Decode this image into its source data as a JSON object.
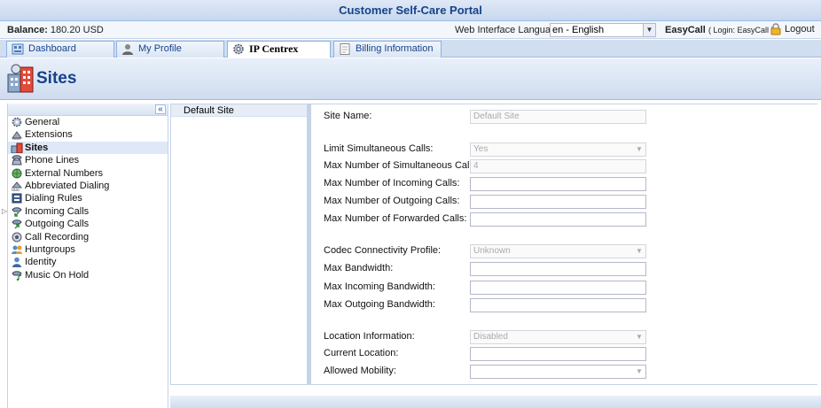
{
  "portal": {
    "title": "Customer Self-Care Portal"
  },
  "infobar": {
    "balance_label": "Balance:",
    "balance_value": "180.20 USD",
    "language_label": "Web Interface Language:",
    "language_value": "en - English",
    "user_name": "EasyCall",
    "login_text": "( Login: EasyCall )",
    "logout_label": "Logout"
  },
  "tabs": [
    {
      "label": "Dashboard",
      "icon": "dashboard-icon"
    },
    {
      "label": "My Profile",
      "icon": "profile-icon"
    },
    {
      "label": "IP Centrex",
      "icon": "gear-icon",
      "active": true
    },
    {
      "label": "Billing Information",
      "icon": "document-icon"
    }
  ],
  "page": {
    "title": "Sites"
  },
  "sidebar": {
    "collapse_label": "«",
    "items": [
      {
        "label": "General",
        "icon": "gear-icon"
      },
      {
        "label": "Extensions",
        "icon": "extensions-icon"
      },
      {
        "label": "Sites",
        "icon": "sites-icon",
        "selected": true
      },
      {
        "label": "Phone Lines",
        "icon": "phone-line-icon"
      },
      {
        "label": "External Numbers",
        "icon": "globe-phone-icon"
      },
      {
        "label": "Abbreviated Dialing",
        "icon": "abbreviated-dialing-icon"
      },
      {
        "label": "Dialing Rules",
        "icon": "dialing-rules-icon"
      },
      {
        "label": "Incoming Calls",
        "icon": "incoming-calls-icon",
        "expandable": true
      },
      {
        "label": "Outgoing Calls",
        "icon": "outgoing-calls-icon"
      },
      {
        "label": "Call Recording",
        "icon": "call-recording-icon"
      },
      {
        "label": "Huntgroups",
        "icon": "huntgroups-icon"
      },
      {
        "label": "Identity",
        "icon": "identity-icon"
      },
      {
        "label": "Music On Hold",
        "icon": "music-on-hold-icon"
      }
    ]
  },
  "sites": {
    "items": [
      "Default Site"
    ]
  },
  "form": {
    "site_name": {
      "label": "Site Name:",
      "value": "Default Site"
    },
    "limit_calls": {
      "label": "Limit Simultaneous Calls:",
      "value": "Yes"
    },
    "max_simultaneous": {
      "label": "Max Number of Simultaneous Calls:",
      "value": "4"
    },
    "max_incoming": {
      "label": "Max Number of Incoming Calls:",
      "value": ""
    },
    "max_outgoing": {
      "label": "Max Number of Outgoing Calls:",
      "value": ""
    },
    "max_forwarded": {
      "label": "Max Number of Forwarded Calls:",
      "value": ""
    },
    "codec_profile": {
      "label": "Codec Connectivity Profile:",
      "value": "Unknown"
    },
    "max_bandwidth": {
      "label": "Max Bandwidth:",
      "value": ""
    },
    "max_in_bandwidth": {
      "label": "Max Incoming Bandwidth:",
      "value": ""
    },
    "max_out_bandwidth": {
      "label": "Max Outgoing Bandwidth:",
      "value": ""
    },
    "location_info": {
      "label": "Location Information:",
      "value": "Disabled"
    },
    "current_location": {
      "label": "Current Location:",
      "value": ""
    },
    "allowed_mobility": {
      "label": "Allowed Mobility:",
      "value": ""
    }
  },
  "colors": {
    "accent": "#15428b",
    "border": "#99bbe8",
    "header_bg": "#dfe8f6"
  }
}
